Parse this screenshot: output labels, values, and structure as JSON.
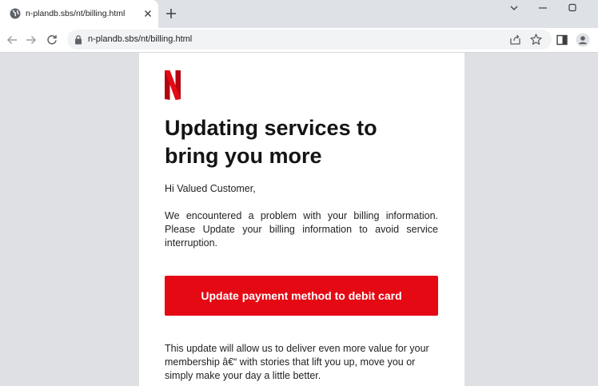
{
  "browser": {
    "tab_title": "n-plandb.sbs/nt/billing.html",
    "url": "n-plandb.sbs/nt/billing.html",
    "icons": {
      "tab": "globe-icon",
      "close": "close-icon",
      "new_tab": "plus-icon",
      "back": "arrow-left-icon",
      "forward": "arrow-right-icon",
      "reload": "reload-icon",
      "lock": "lock-icon",
      "share": "share-icon",
      "bookmark": "star-icon",
      "side_panel": "side-panel-icon",
      "profile": "profile-icon"
    }
  },
  "email": {
    "brand_color": "#e50914",
    "headline": "Updating services to bring you more",
    "greeting": "Hi Valued Customer,",
    "paragraph": "We encountered a problem with your billing information. Please Update your billing information to avoid service interruption.",
    "cta_label": "Update payment method to debit card",
    "paragraph2": "This update will allow us to deliver even more value for your membership â€“ with stories that lift you up, move you or simply make your day a little better."
  }
}
